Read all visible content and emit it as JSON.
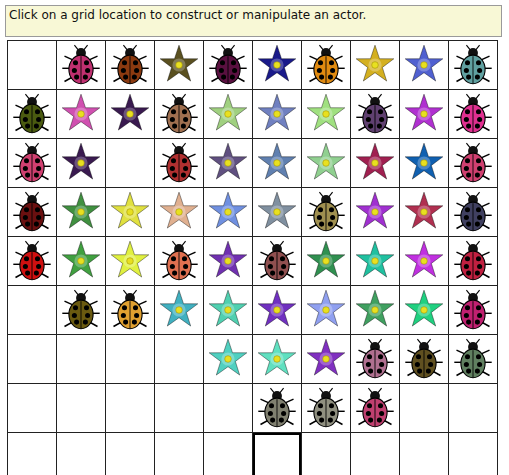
{
  "message": "Click on a grid location to construct or manipulate an actor.",
  "grid": {
    "rows": [
      [
        {
          "kind": "empty",
          "selected": false
        },
        {
          "kind": "bug",
          "color": "#c03070",
          "selected": false
        },
        {
          "kind": "bug",
          "color": "#8b3a10",
          "selected": false
        },
        {
          "kind": "flower",
          "color": "#5a5020",
          "selected": false
        },
        {
          "kind": "bug",
          "color": "#5a1040",
          "selected": false
        },
        {
          "kind": "flower",
          "color": "#1a1a8a",
          "selected": false
        },
        {
          "kind": "bug",
          "color": "#e08a10",
          "selected": false
        },
        {
          "kind": "flower",
          "color": "#d4b020",
          "selected": false
        },
        {
          "kind": "flower",
          "color": "#5060d0",
          "selected": false
        },
        {
          "kind": "bug",
          "color": "#60a0a0",
          "selected": false
        }
      ],
      [
        {
          "kind": "bug",
          "color": "#4a5a10",
          "selected": false
        },
        {
          "kind": "flower",
          "color": "#d050b0",
          "selected": false
        },
        {
          "kind": "flower",
          "color": "#3a1a50",
          "selected": false
        },
        {
          "kind": "bug",
          "color": "#a07050",
          "selected": false
        },
        {
          "kind": "flower",
          "color": "#a0d080",
          "selected": false
        },
        {
          "kind": "flower",
          "color": "#7080c0",
          "selected": false
        },
        {
          "kind": "flower",
          "color": "#a0e080",
          "selected": false
        },
        {
          "kind": "bug",
          "color": "#604070",
          "selected": false
        },
        {
          "kind": "flower",
          "color": "#b030d0",
          "selected": false
        },
        {
          "kind": "bug",
          "color": "#e03090",
          "selected": false
        }
      ],
      [
        {
          "kind": "bug",
          "color": "#d04070",
          "selected": false
        },
        {
          "kind": "flower",
          "color": "#3a1a50",
          "selected": false
        },
        {
          "kind": "empty",
          "selected": false
        },
        {
          "kind": "bug",
          "color": "#b03030",
          "selected": false
        },
        {
          "kind": "flower",
          "color": "#605080",
          "selected": false
        },
        {
          "kind": "flower",
          "color": "#6080b0",
          "selected": false
        },
        {
          "kind": "flower",
          "color": "#90d090",
          "selected": false
        },
        {
          "kind": "flower",
          "color": "#a02050",
          "selected": false
        },
        {
          "kind": "flower",
          "color": "#1060b0",
          "selected": false
        },
        {
          "kind": "bug",
          "color": "#d04070",
          "selected": false
        }
      ],
      [
        {
          "kind": "bug",
          "color": "#6a1010",
          "selected": false
        },
        {
          "kind": "flower",
          "color": "#409040",
          "selected": false
        },
        {
          "kind": "flower",
          "color": "#e0e040",
          "selected": false
        },
        {
          "kind": "flower",
          "color": "#e0b090",
          "selected": false
        },
        {
          "kind": "flower",
          "color": "#7090e0",
          "selected": false
        },
        {
          "kind": "flower",
          "color": "#8090a0",
          "selected": false
        },
        {
          "kind": "bug",
          "color": "#a09050",
          "selected": false
        },
        {
          "kind": "flower",
          "color": "#a030d0",
          "selected": false
        },
        {
          "kind": "flower",
          "color": "#b03050",
          "selected": false
        },
        {
          "kind": "bug",
          "color": "#404060",
          "selected": false
        }
      ],
      [
        {
          "kind": "bug",
          "color": "#d01010",
          "selected": false
        },
        {
          "kind": "flower",
          "color": "#40a040",
          "selected": false
        },
        {
          "kind": "flower",
          "color": "#e0f040",
          "selected": false
        },
        {
          "kind": "bug",
          "color": "#e07050",
          "selected": false
        },
        {
          "kind": "flower",
          "color": "#7030b0",
          "selected": false
        },
        {
          "kind": "bug",
          "color": "#905050",
          "selected": false
        },
        {
          "kind": "flower",
          "color": "#309050",
          "selected": false
        },
        {
          "kind": "flower",
          "color": "#20c0a0",
          "selected": false
        },
        {
          "kind": "flower",
          "color": "#c030e0",
          "selected": false
        },
        {
          "kind": "bug",
          "color": "#c02040",
          "selected": false
        }
      ],
      [
        {
          "kind": "empty",
          "selected": false
        },
        {
          "kind": "bug",
          "color": "#6a5a10",
          "selected": false
        },
        {
          "kind": "bug",
          "color": "#e0a030",
          "selected": false
        },
        {
          "kind": "flower",
          "color": "#40b0c0",
          "selected": false
        },
        {
          "kind": "flower",
          "color": "#50d0b0",
          "selected": false
        },
        {
          "kind": "flower",
          "color": "#7030c0",
          "selected": false
        },
        {
          "kind": "flower",
          "color": "#90a0f0",
          "selected": false
        },
        {
          "kind": "flower",
          "color": "#40a060",
          "selected": false
        },
        {
          "kind": "flower",
          "color": "#20d080",
          "selected": false
        },
        {
          "kind": "bug",
          "color": "#c02070",
          "selected": false
        }
      ],
      [
        {
          "kind": "empty",
          "selected": false
        },
        {
          "kind": "empty",
          "selected": false
        },
        {
          "kind": "empty",
          "selected": false
        },
        {
          "kind": "empty",
          "selected": false
        },
        {
          "kind": "flower",
          "color": "#50d0c0",
          "selected": false
        },
        {
          "kind": "flower",
          "color": "#60e0c0",
          "selected": false
        },
        {
          "kind": "flower",
          "color": "#8030c0",
          "selected": false
        },
        {
          "kind": "bug",
          "color": "#b07090",
          "selected": false
        },
        {
          "kind": "bug",
          "color": "#605020",
          "selected": false
        },
        {
          "kind": "bug",
          "color": "#608060",
          "selected": false
        }
      ],
      [
        {
          "kind": "empty",
          "selected": false
        },
        {
          "kind": "empty",
          "selected": false
        },
        {
          "kind": "empty",
          "selected": false
        },
        {
          "kind": "empty",
          "selected": false
        },
        {
          "kind": "empty",
          "selected": false
        },
        {
          "kind": "bug",
          "color": "#808070",
          "selected": false
        },
        {
          "kind": "bug",
          "color": "#909080",
          "selected": false
        },
        {
          "kind": "bug",
          "color": "#c04070",
          "selected": false
        },
        {
          "kind": "empty",
          "selected": false
        },
        {
          "kind": "empty",
          "selected": false
        }
      ],
      [
        {
          "kind": "empty",
          "selected": false
        },
        {
          "kind": "empty",
          "selected": false
        },
        {
          "kind": "empty",
          "selected": false
        },
        {
          "kind": "empty",
          "selected": false
        },
        {
          "kind": "empty",
          "selected": false
        },
        {
          "kind": "empty",
          "selected": true
        },
        {
          "kind": "empty",
          "selected": false
        },
        {
          "kind": "empty",
          "selected": false
        },
        {
          "kind": "empty",
          "selected": false
        },
        {
          "kind": "empty",
          "selected": false
        }
      ]
    ]
  }
}
